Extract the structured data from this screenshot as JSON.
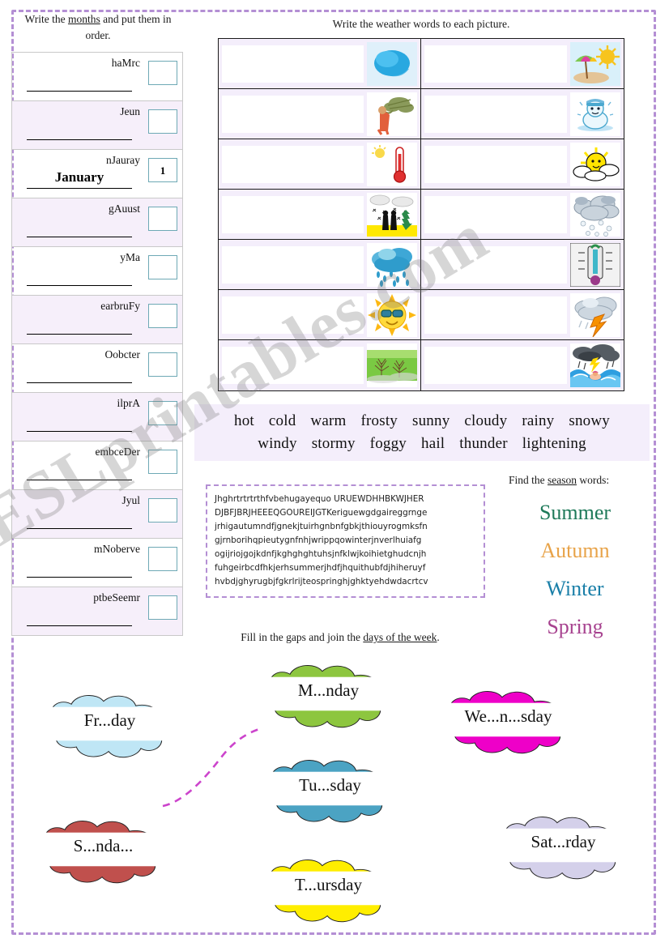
{
  "months": {
    "title_pre": "Write the ",
    "title_link": "months",
    "title_post": " and put them in order.",
    "rows": [
      {
        "scramble": "haMrc",
        "answer": "",
        "number": ""
      },
      {
        "scramble": "Jeun",
        "answer": "",
        "number": ""
      },
      {
        "scramble": "nJauray",
        "answer": "January",
        "number": "1"
      },
      {
        "scramble": "gAuust",
        "answer": "",
        "number": ""
      },
      {
        "scramble": "yMa",
        "answer": "",
        "number": ""
      },
      {
        "scramble": "earbruFy",
        "answer": "",
        "number": ""
      },
      {
        "scramble": "Oobcter",
        "answer": "",
        "number": ""
      },
      {
        "scramble": "ilprA",
        "answer": "",
        "number": ""
      },
      {
        "scramble": "embceDer",
        "answer": "",
        "number": ""
      },
      {
        "scramble": "Jyul",
        "answer": "",
        "number": ""
      },
      {
        "scramble": "mNoberve",
        "answer": "",
        "number": ""
      },
      {
        "scramble": "ptbeSeemr",
        "answer": "",
        "number": ""
      }
    ]
  },
  "weather": {
    "title": "Write the weather words to each picture.",
    "cells": [
      {
        "icon": "blue-paint-splash-icon",
        "answer": ""
      },
      {
        "icon": "beach-umbrella-sun-icon",
        "answer": ""
      },
      {
        "icon": "windy-tree-person-icon",
        "answer": ""
      },
      {
        "icon": "frozen-snowman-icon",
        "answer": ""
      },
      {
        "icon": "thermometer-hot-icon",
        "answer": ""
      },
      {
        "icon": "sun-behind-cloud-icon",
        "answer": ""
      },
      {
        "icon": "snowfall-people-icon",
        "answer": ""
      },
      {
        "icon": "hail-cloud-icon",
        "answer": ""
      },
      {
        "icon": "rain-cloud-icon",
        "answer": ""
      },
      {
        "icon": "cold-thermometer-icon",
        "answer": ""
      },
      {
        "icon": "sunglasses-sun-icon",
        "answer": ""
      },
      {
        "icon": "lightning-cloud-icon",
        "answer": ""
      },
      {
        "icon": "foggy-field-icon",
        "answer": ""
      },
      {
        "icon": "stormy-sea-icon",
        "answer": ""
      }
    ]
  },
  "wordbank": {
    "row1": [
      "hot",
      "cold",
      "warm",
      "frosty",
      "sunny",
      "cloudy",
      "rainy",
      "snowy"
    ],
    "row2": [
      "windy",
      "stormy",
      "foggy",
      "hail",
      "thunder",
      "lightening"
    ]
  },
  "jumble": {
    "lines": [
      "Jhghrtrtrtrthfvbehugayequo URUEWDHHBKWJHER",
      "DJBFJBRJHEEEQGOUREIJGTKeriguewgdgaireggrnge",
      "jrhigautumndfjgnekjtuirhgnbnfgbkjthiouyrogmksfn",
      "gjrnborihqpieutygnfnhjwrippqowinterjnverlhuiafg",
      "ogijriojgojkdnfjkghghghtuhsjnfklwjkoihietghudcnjh",
      "fuhgeirbcdfhkjerhsummerjhdfjhquithubfdjhiheruyf",
      "hvbdjghyrugbjfgkrlrijteospringhjghktyehdwdacrtcv"
    ]
  },
  "seasons": {
    "title_pre": "Find the ",
    "title_link": "season",
    "title_post": " words:",
    "words": [
      {
        "label": "Summer",
        "color": "#1f7a5a"
      },
      {
        "label": "Autumn",
        "color": "#e8a349"
      },
      {
        "label": "Winter",
        "color": "#1a7fa8"
      },
      {
        "label": "Spring",
        "color": "#a7428f"
      }
    ]
  },
  "days": {
    "title_pre": "Fill in the gaps and join the ",
    "title_link": "days of the week",
    "title_post": ".",
    "clouds": [
      {
        "label": "Fr...day",
        "color": "#bfe6f5",
        "name": "friday"
      },
      {
        "label": "M...nday",
        "color": "#8dc63f",
        "name": "monday"
      },
      {
        "label": "We...n...sday",
        "color": "#ee00c8",
        "name": "wednesday"
      },
      {
        "label": "Tu...sday",
        "color": "#4ba3c3",
        "name": "tuesday"
      },
      {
        "label": "S...nda...",
        "color": "#c0504d",
        "name": "sunday"
      },
      {
        "label": "Sat...rday",
        "color": "#d4d0ea",
        "name": "saturday"
      },
      {
        "label": "T...ursday",
        "color": "#ffee00",
        "name": "thursday"
      }
    ]
  },
  "watermark": {
    "text": "ESLprintables.com"
  },
  "colors": {
    "frame": "#b48fd4",
    "row_alt": "#f6effa",
    "weather_bg": "#f4eefb",
    "answer_box_border": "#6ea9b5"
  }
}
